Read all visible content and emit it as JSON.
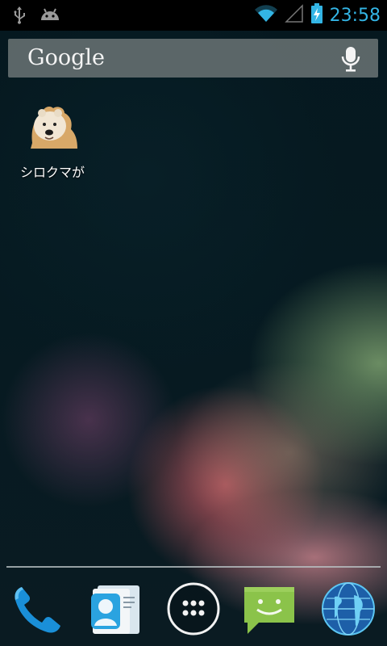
{
  "status_bar": {
    "time": "23:58",
    "left_icons": [
      "usb-icon",
      "android-debug-icon"
    ],
    "right_icons": [
      "wifi-icon",
      "cell-signal-icon",
      "battery-charging-icon"
    ],
    "clock_color": "#33b5e5"
  },
  "search_bar": {
    "logo_text": "Google",
    "mic_icon": "microphone-icon"
  },
  "home_apps": [
    {
      "label": "シロクマが",
      "icon": "polar-bear-icon"
    }
  ],
  "dock": {
    "items": [
      {
        "icon": "phone-icon"
      },
      {
        "icon": "contacts-icon"
      },
      {
        "icon": "app-drawer-icon"
      },
      {
        "icon": "messaging-icon"
      },
      {
        "icon": "browser-globe-icon"
      }
    ]
  }
}
